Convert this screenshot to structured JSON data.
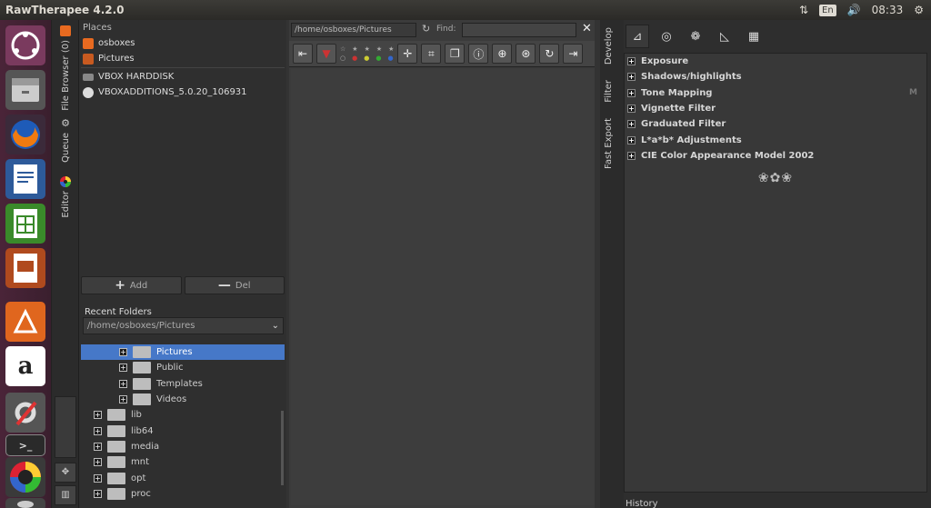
{
  "window": {
    "title": "RawTherapee 4.2.0"
  },
  "topbar": {
    "lang": "En",
    "time": "08:33"
  },
  "left_tabs": {
    "file_browser": "File Browser (0)",
    "queue": "Queue",
    "editor": "Editor"
  },
  "places": {
    "header": "Places",
    "items": [
      "osboxes",
      "Pictures",
      "VBOX HARDDISK",
      "VBOXADDITIONS_5.0.20_106931"
    ],
    "add_label": "Add",
    "del_label": "Del"
  },
  "recent": {
    "label": "Recent Folders",
    "value": "/home/osboxes/Pictures"
  },
  "tree": {
    "sub": [
      "Pictures",
      "Public",
      "Templates",
      "Videos"
    ],
    "top": [
      "lib",
      "lib64",
      "media",
      "mnt",
      "opt",
      "proc"
    ]
  },
  "browser": {
    "path": "/home/osboxes/Pictures",
    "find_label": "Find:",
    "find_value": ""
  },
  "right_tabs": {
    "develop": "Develop",
    "filter": "Filter",
    "fast_export": "Fast Export"
  },
  "tools": {
    "items": [
      "Exposure",
      "Shadows/highlights",
      "Tone Mapping",
      "Vignette Filter",
      "Graduated Filter",
      "L*a*b* Adjustments",
      "CIE Color Appearance Model 2002"
    ],
    "tone_mapping_flag": "M",
    "history_label": "History"
  },
  "colors": {
    "selection": "#4678c8",
    "launcher": "#4a2438"
  }
}
